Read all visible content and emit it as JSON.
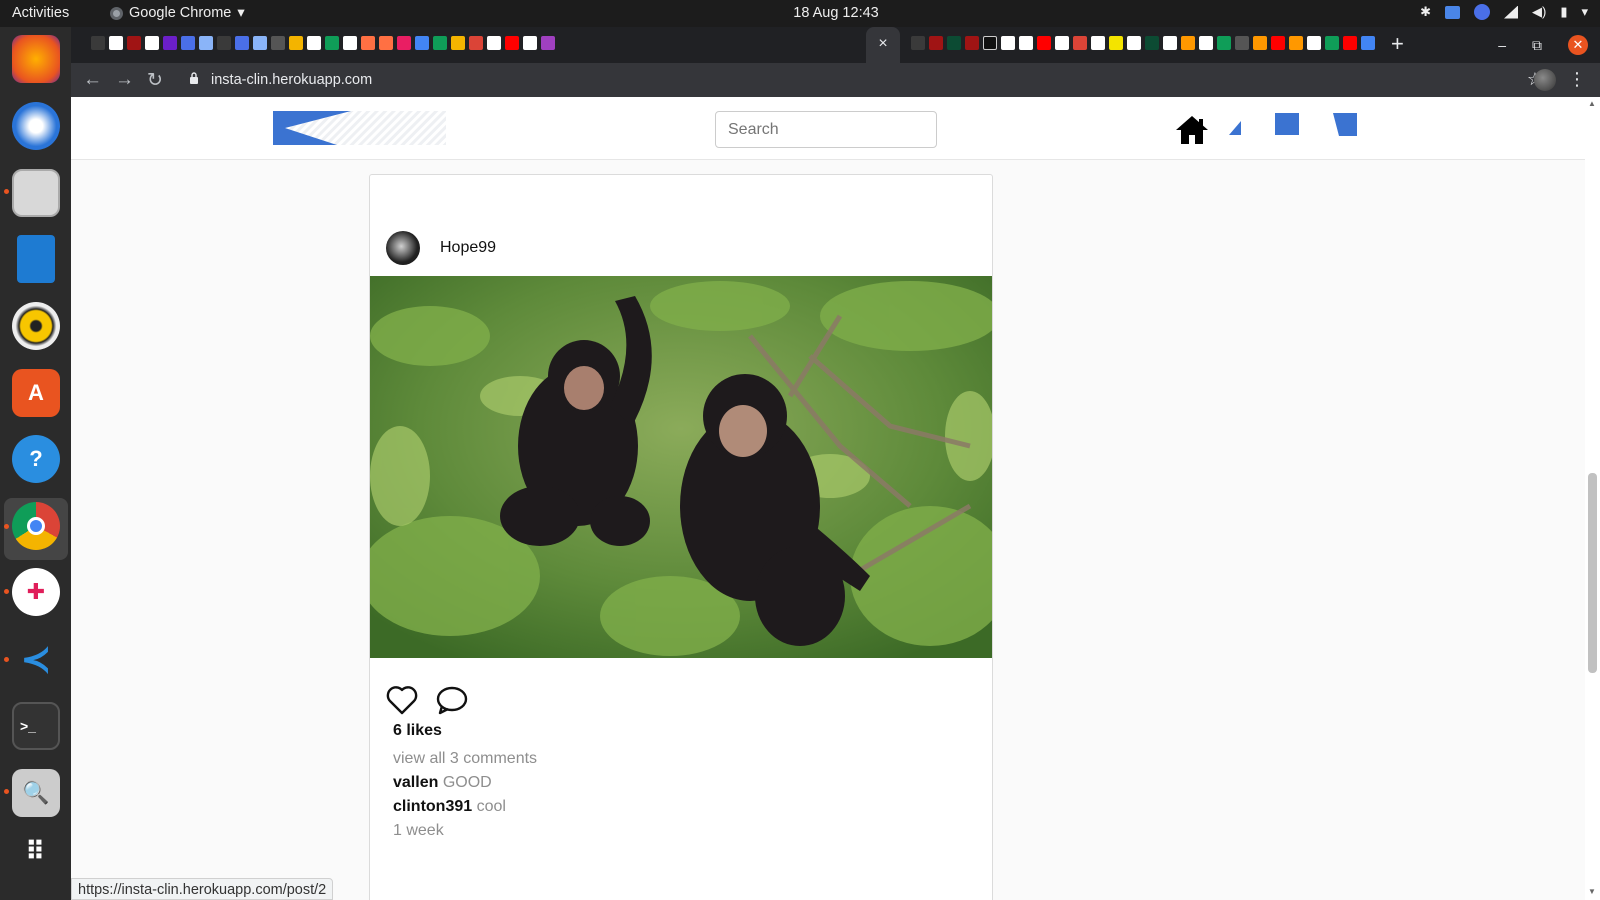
{
  "os": {
    "activities": "Activities",
    "app_name": "Google Chrome",
    "clock": "18 Aug  12:43"
  },
  "browser": {
    "url": "insta-clin.herokuapp.com",
    "active_tab_close": "×",
    "new_tab": "+",
    "status_url": "https://insta-clin.herokuapp.com/post/2"
  },
  "site": {
    "search_placeholder": "Search",
    "accent_color": "#3b73d1"
  },
  "post": {
    "username": "Hope99",
    "likes": "6 likes",
    "view_all": "view all 3 comments",
    "comments": [
      {
        "user": "vallen",
        "text": "GOOD"
      },
      {
        "user": "clinton391",
        "text": "cool"
      }
    ],
    "time": "1 week"
  }
}
